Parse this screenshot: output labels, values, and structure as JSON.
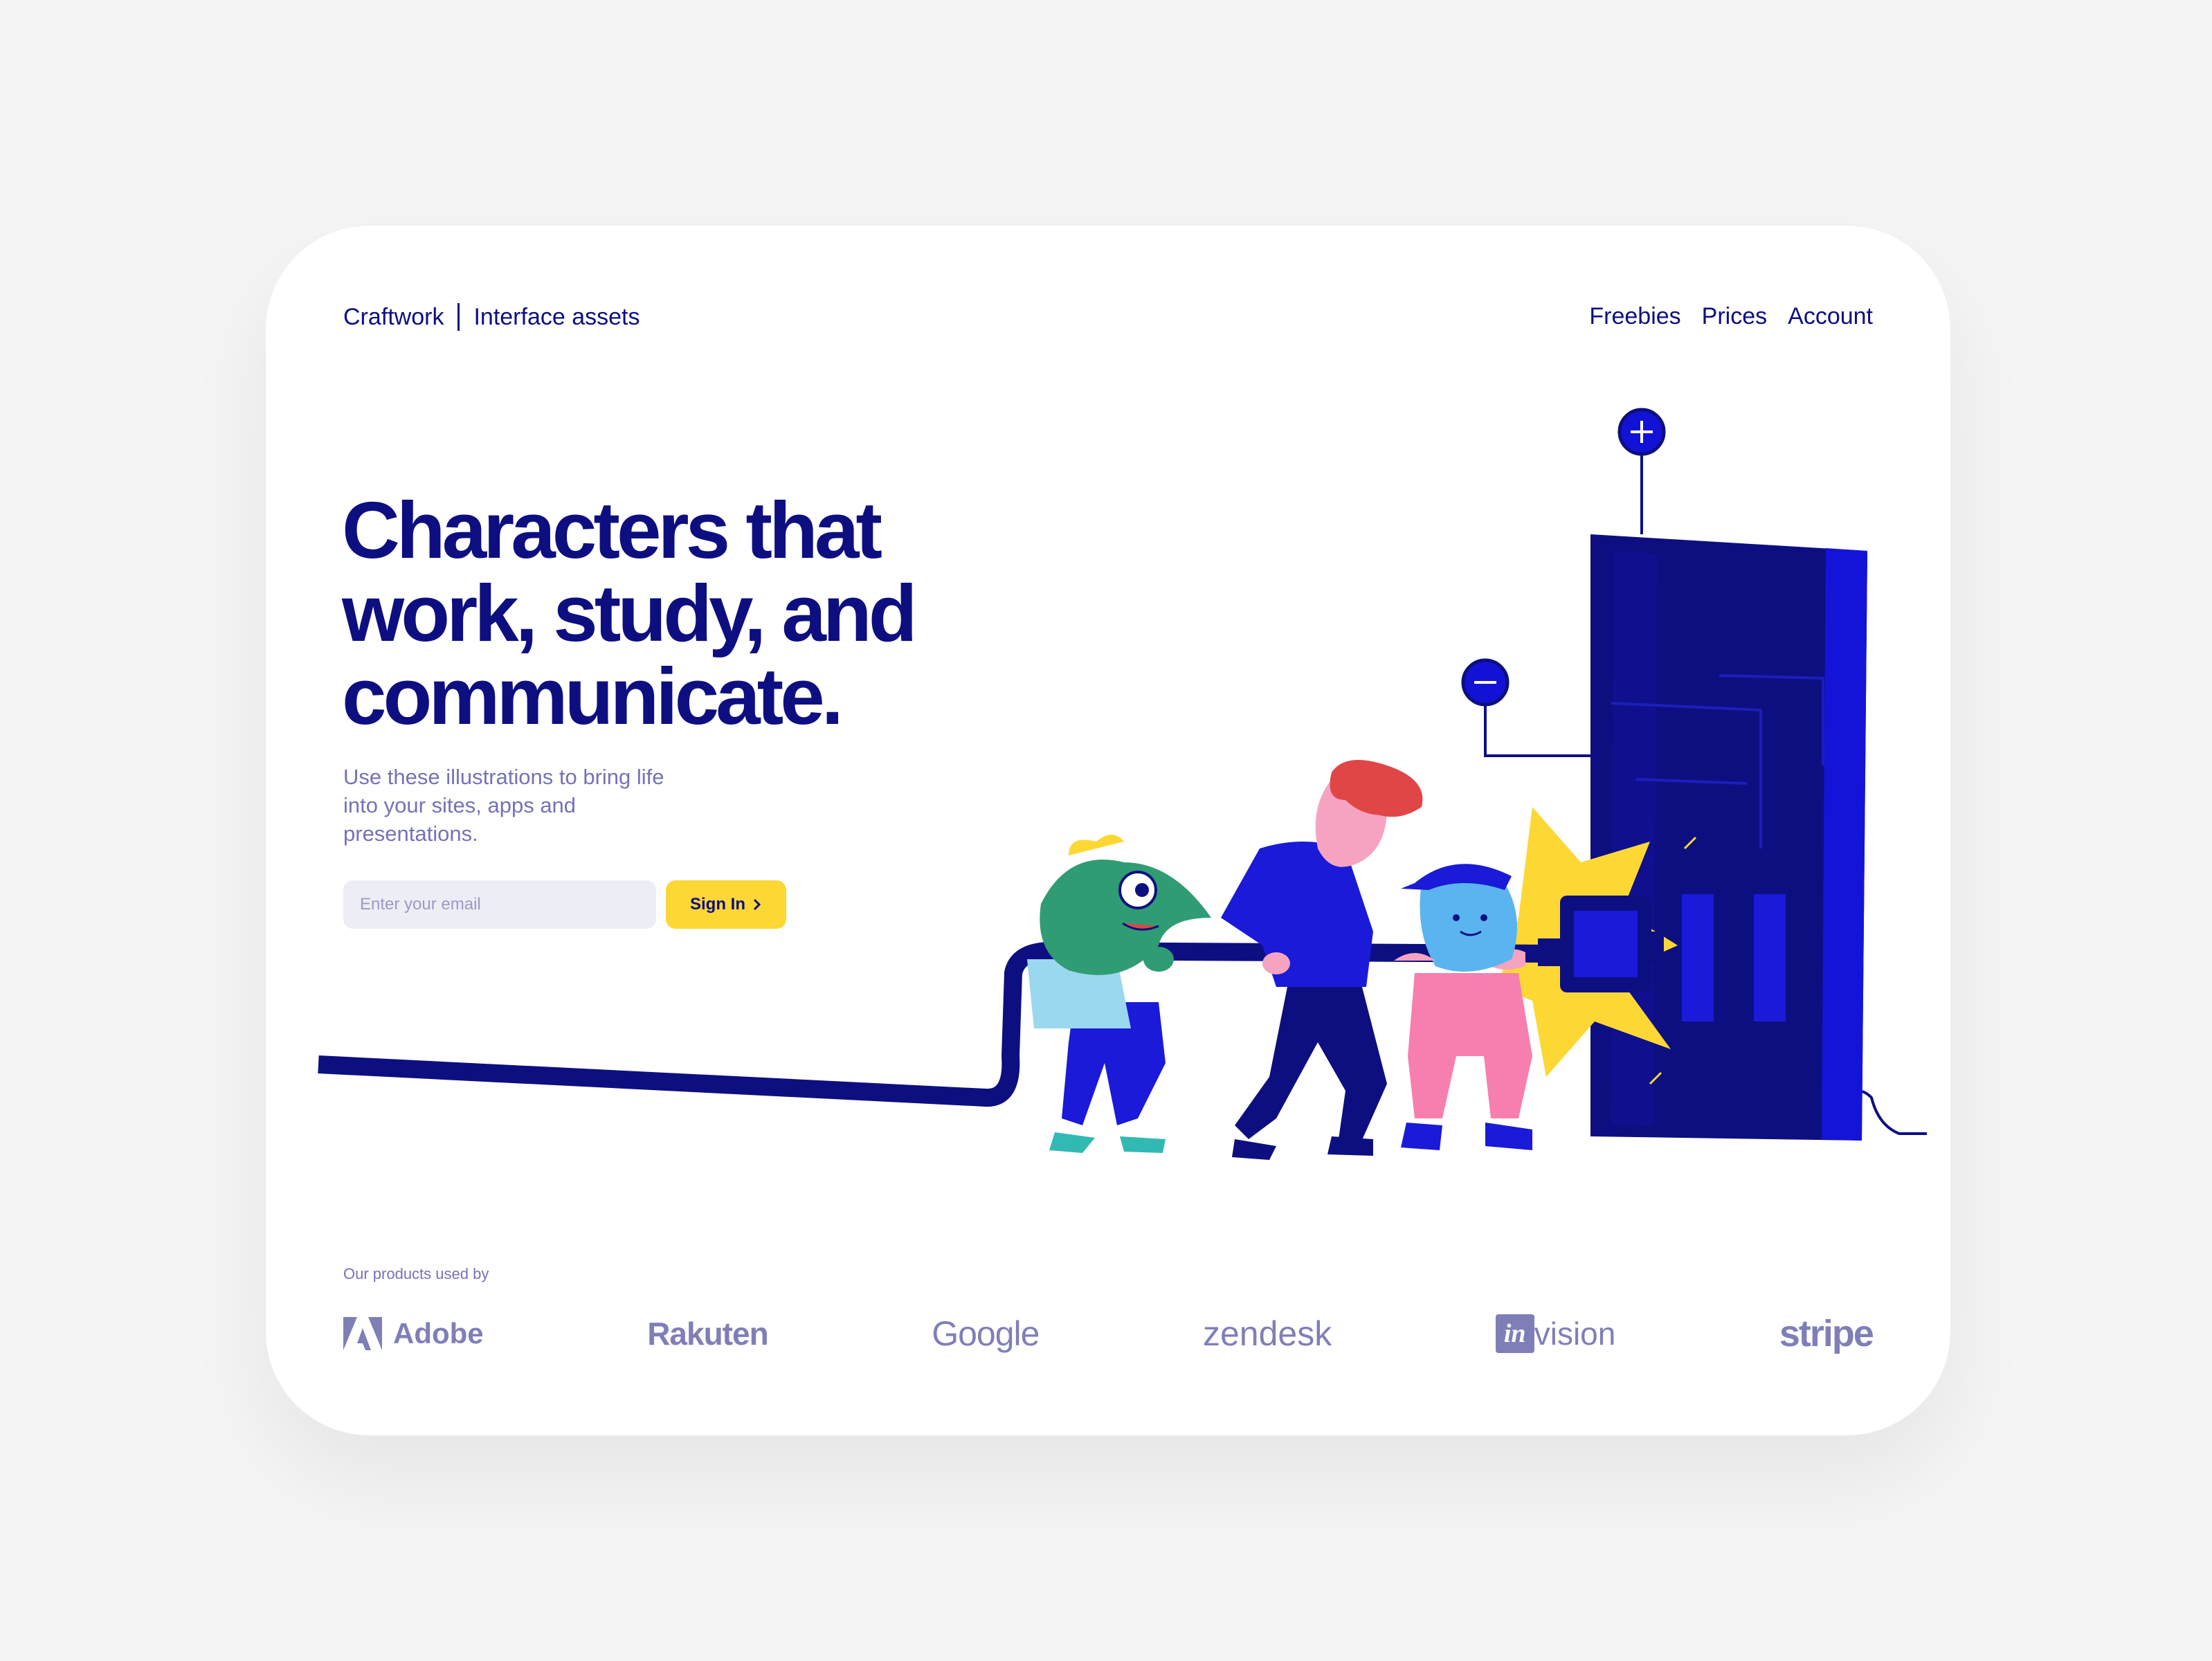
{
  "header": {
    "brand": "Craftwork",
    "subtitle": "Interface assets",
    "nav": [
      "Freebies",
      "Prices",
      "Account"
    ]
  },
  "hero": {
    "title": "Characters that work, study, and communicate.",
    "description": "Use these illustrations to bring life into your sites, apps and presentations.",
    "email_placeholder": "Enter your email",
    "signin_label": "Sign In"
  },
  "clients": {
    "caption": "Our products used by",
    "logos": [
      {
        "name": "Adobe",
        "icon": "adobe-icon"
      },
      {
        "name": "Rakuten"
      },
      {
        "name": "Google"
      },
      {
        "name": "zendesk"
      },
      {
        "prefix": "in",
        "name": "vision",
        "icon": "invision-icon"
      },
      {
        "name": "stripe"
      }
    ]
  },
  "colors": {
    "background": "#f4f4f4",
    "card": "#ffffff",
    "navy": "#0d0f80",
    "muted": "#7472b8",
    "accent_yellow": "#fdd835",
    "input_bg": "#ecedf5",
    "logo_gray": "#7f7fb8"
  }
}
